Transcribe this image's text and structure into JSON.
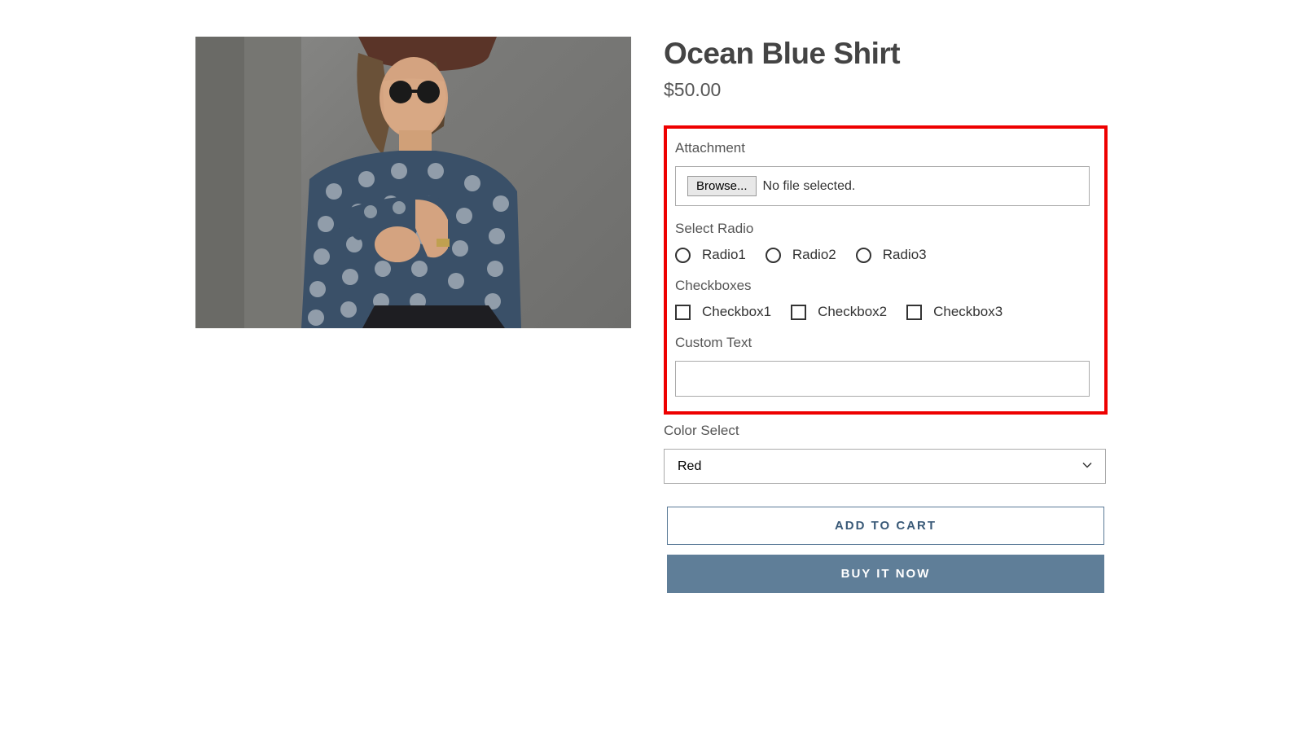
{
  "product": {
    "title": "Ocean Blue Shirt",
    "price": "$50.00"
  },
  "form": {
    "attachment": {
      "label": "Attachment",
      "browse_label": "Browse...",
      "status": "No file selected."
    },
    "radio": {
      "label": "Select Radio",
      "options": [
        "Radio1",
        "Radio2",
        "Radio3"
      ]
    },
    "checkbox": {
      "label": "Checkboxes",
      "options": [
        "Checkbox1",
        "Checkbox2",
        "Checkbox3"
      ]
    },
    "custom_text": {
      "label": "Custom Text",
      "value": ""
    },
    "color": {
      "label": "Color Select",
      "selected": "Red"
    }
  },
  "buttons": {
    "add_to_cart": "ADD TO CART",
    "buy_now": "BUY IT NOW"
  }
}
